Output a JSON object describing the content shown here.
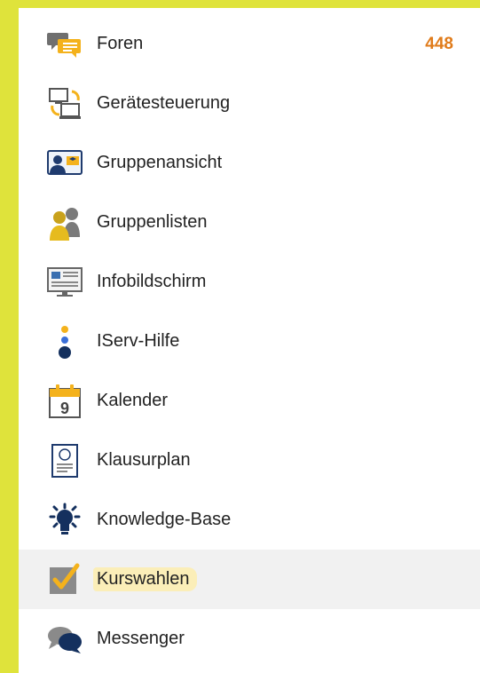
{
  "colors": {
    "accent": "#dfe33b",
    "count": "#e07b1a",
    "active_bg": "#f1f1f1",
    "highlight": "#fbeeb8"
  },
  "menu": {
    "items": [
      {
        "label": "Foren",
        "icon": "forum-icon",
        "count": "448"
      },
      {
        "label": "Gerätesteuerung",
        "icon": "device-control-icon"
      },
      {
        "label": "Gruppenansicht",
        "icon": "group-view-icon"
      },
      {
        "label": "Gruppenlisten",
        "icon": "group-list-icon"
      },
      {
        "label": "Infobildschirm",
        "icon": "info-screen-icon"
      },
      {
        "label": "IServ-Hilfe",
        "icon": "help-icon"
      },
      {
        "label": "Kalender",
        "icon": "calendar-icon",
        "icon_text": "9"
      },
      {
        "label": "Klausurplan",
        "icon": "exam-plan-icon"
      },
      {
        "label": "Knowledge-Base",
        "icon": "lightbulb-icon"
      },
      {
        "label": "Kurswahlen",
        "icon": "checkbox-icon",
        "active": true
      },
      {
        "label": "Messenger",
        "icon": "messenger-icon"
      }
    ]
  }
}
